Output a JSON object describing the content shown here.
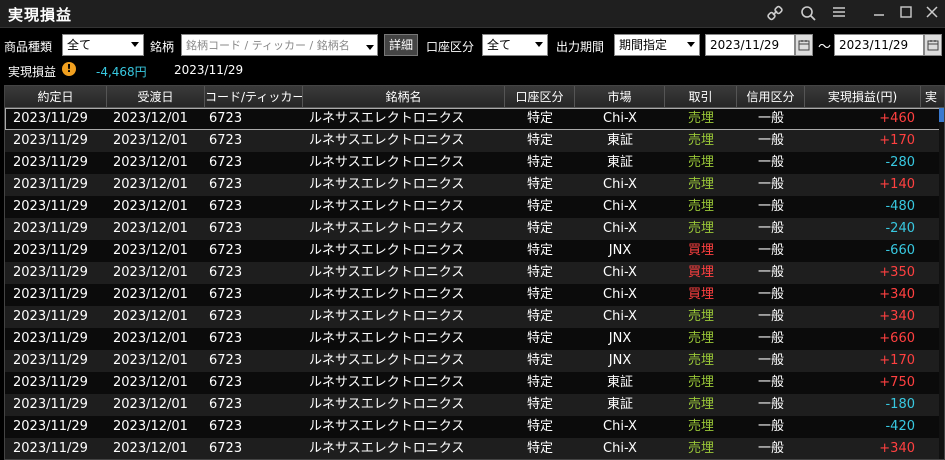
{
  "window": {
    "title": "実現損益"
  },
  "toolbar_icons": [
    "link-icon",
    "search-icon",
    "menu-icon",
    "minimize-icon",
    "maximize-icon",
    "close-icon"
  ],
  "filters": {
    "product_type_label": "商品種類",
    "product_type_value": "全て",
    "symbol_label": "銘柄",
    "symbol_placeholder": "銘柄コード / ティッカー / 銘柄名",
    "detail_button": "詳細",
    "account_label": "口座区分",
    "account_value": "全て",
    "period_label": "出力期間",
    "period_value": "期間指定",
    "date_from": "2023/11/29",
    "tilde": "～",
    "date_to": "2023/11/29"
  },
  "summary": {
    "label": "実現損益",
    "warning": "!",
    "value": "-4,468円",
    "date": "2023/11/29"
  },
  "columns": [
    "約定日",
    "受渡日",
    "コード/ティッカー",
    "銘柄名",
    "口座区分",
    "市場",
    "取引",
    "信用区分",
    "実現損益(円)",
    "実"
  ],
  "colors": {
    "sell": "#9ac838",
    "buy": "#ff4040",
    "positive": "#ff4040",
    "negative": "#38c8e0"
  },
  "rows": [
    {
      "trade_date": "2023/11/29",
      "settle_date": "2023/12/01",
      "code": "6723",
      "name": "ルネサスエレクトロニクス",
      "account": "特定",
      "market": "Chi-X",
      "side": "売埋",
      "side_type": "sell",
      "margin": "一般",
      "pnl": "+460",
      "pnl_sign": "positive"
    },
    {
      "trade_date": "2023/11/29",
      "settle_date": "2023/12/01",
      "code": "6723",
      "name": "ルネサスエレクトロニクス",
      "account": "特定",
      "market": "東証",
      "side": "売埋",
      "side_type": "sell",
      "margin": "一般",
      "pnl": "+170",
      "pnl_sign": "positive"
    },
    {
      "trade_date": "2023/11/29",
      "settle_date": "2023/12/01",
      "code": "6723",
      "name": "ルネサスエレクトロニクス",
      "account": "特定",
      "market": "東証",
      "side": "売埋",
      "side_type": "sell",
      "margin": "一般",
      "pnl": "-280",
      "pnl_sign": "negative"
    },
    {
      "trade_date": "2023/11/29",
      "settle_date": "2023/12/01",
      "code": "6723",
      "name": "ルネサスエレクトロニクス",
      "account": "特定",
      "market": "Chi-X",
      "side": "売埋",
      "side_type": "sell",
      "margin": "一般",
      "pnl": "+140",
      "pnl_sign": "positive"
    },
    {
      "trade_date": "2023/11/29",
      "settle_date": "2023/12/01",
      "code": "6723",
      "name": "ルネサスエレクトロニクス",
      "account": "特定",
      "market": "Chi-X",
      "side": "売埋",
      "side_type": "sell",
      "margin": "一般",
      "pnl": "-480",
      "pnl_sign": "negative"
    },
    {
      "trade_date": "2023/11/29",
      "settle_date": "2023/12/01",
      "code": "6723",
      "name": "ルネサスエレクトロニクス",
      "account": "特定",
      "market": "Chi-X",
      "side": "売埋",
      "side_type": "sell",
      "margin": "一般",
      "pnl": "-240",
      "pnl_sign": "negative"
    },
    {
      "trade_date": "2023/11/29",
      "settle_date": "2023/12/01",
      "code": "6723",
      "name": "ルネサスエレクトロニクス",
      "account": "特定",
      "market": "JNX",
      "side": "買埋",
      "side_type": "buy",
      "margin": "一般",
      "pnl": "-660",
      "pnl_sign": "negative"
    },
    {
      "trade_date": "2023/11/29",
      "settle_date": "2023/12/01",
      "code": "6723",
      "name": "ルネサスエレクトロニクス",
      "account": "特定",
      "market": "Chi-X",
      "side": "買埋",
      "side_type": "buy",
      "margin": "一般",
      "pnl": "+350",
      "pnl_sign": "positive"
    },
    {
      "trade_date": "2023/11/29",
      "settle_date": "2023/12/01",
      "code": "6723",
      "name": "ルネサスエレクトロニクス",
      "account": "特定",
      "market": "Chi-X",
      "side": "買埋",
      "side_type": "buy",
      "margin": "一般",
      "pnl": "+340",
      "pnl_sign": "positive"
    },
    {
      "trade_date": "2023/11/29",
      "settle_date": "2023/12/01",
      "code": "6723",
      "name": "ルネサスエレクトロニクス",
      "account": "特定",
      "market": "Chi-X",
      "side": "売埋",
      "side_type": "sell",
      "margin": "一般",
      "pnl": "+340",
      "pnl_sign": "positive"
    },
    {
      "trade_date": "2023/11/29",
      "settle_date": "2023/12/01",
      "code": "6723",
      "name": "ルネサスエレクトロニクス",
      "account": "特定",
      "market": "JNX",
      "side": "売埋",
      "side_type": "sell",
      "margin": "一般",
      "pnl": "+660",
      "pnl_sign": "positive"
    },
    {
      "trade_date": "2023/11/29",
      "settle_date": "2023/12/01",
      "code": "6723",
      "name": "ルネサスエレクトロニクス",
      "account": "特定",
      "market": "JNX",
      "side": "売埋",
      "side_type": "sell",
      "margin": "一般",
      "pnl": "+170",
      "pnl_sign": "positive"
    },
    {
      "trade_date": "2023/11/29",
      "settle_date": "2023/12/01",
      "code": "6723",
      "name": "ルネサスエレクトロニクス",
      "account": "特定",
      "market": "東証",
      "side": "売埋",
      "side_type": "sell",
      "margin": "一般",
      "pnl": "+750",
      "pnl_sign": "positive"
    },
    {
      "trade_date": "2023/11/29",
      "settle_date": "2023/12/01",
      "code": "6723",
      "name": "ルネサスエレクトロニクス",
      "account": "特定",
      "market": "東証",
      "side": "売埋",
      "side_type": "sell",
      "margin": "一般",
      "pnl": "-180",
      "pnl_sign": "negative"
    },
    {
      "trade_date": "2023/11/29",
      "settle_date": "2023/12/01",
      "code": "6723",
      "name": "ルネサスエレクトロニクス",
      "account": "特定",
      "market": "Chi-X",
      "side": "売埋",
      "side_type": "sell",
      "margin": "一般",
      "pnl": "-420",
      "pnl_sign": "negative"
    },
    {
      "trade_date": "2023/11/29",
      "settle_date": "2023/12/01",
      "code": "6723",
      "name": "ルネサスエレクトロニクス",
      "account": "特定",
      "market": "Chi-X",
      "side": "売埋",
      "side_type": "sell",
      "margin": "一般",
      "pnl": "+340",
      "pnl_sign": "positive"
    }
  ]
}
